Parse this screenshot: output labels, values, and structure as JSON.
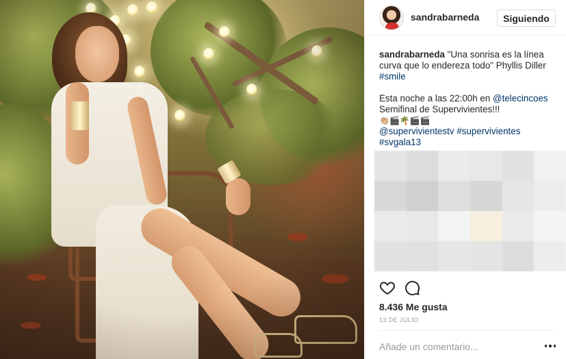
{
  "post": {
    "username": "sandrabarneda",
    "follow_button": "Siguiendo",
    "photo_alt": "",
    "caption": {
      "username": "sandrabarneda",
      "quote": " \"Una sonrisa es la línea curva que lo endereza todo\" Phyllis Diller ",
      "hashtag_smile": "#smile",
      "line2_prefix": "Esta noche a las 22:00h en ",
      "mention_telecinco": "@telecincoes",
      "line3": "Semifinal de Supervivientes!!!",
      "emoji_line": "👏🏼🎬🌴🎬🎬",
      "mention_supervivientes": "@supervivientestv",
      "hashtag_supervivientes": "#supervivientes",
      "hashtag_svgala": "#svgala13"
    },
    "likes": "8.436 Me gusta",
    "date": "13 DE JULIO",
    "comment_placeholder": "Añade un comentario..."
  },
  "colors": {
    "text": "#262626",
    "link": "#003569",
    "muted": "#999999",
    "border": "#efefef"
  },
  "icons": {
    "like": "heart-outline-icon",
    "comment": "speech-bubble-icon",
    "more": "ellipsis-icon"
  },
  "blurred_block_colors": [
    "#e4e4e4",
    "#dcdcdc",
    "#ebebeb",
    "#e8e8e8",
    "#e2e2e2",
    "#f2f2f2",
    "#d8d8d8",
    "#d2d0ce",
    "#dedede",
    "#d6d6d6",
    "#e6e6e6",
    "#ececec",
    "#eaeaea",
    "#e8e8e8",
    "#f3f3f3",
    "#f6efe0",
    "#ebebeb",
    "#f4f4f4",
    "#e2e2e2",
    "#e0e0e0",
    "#e6e6e6",
    "#e4e4e4",
    "#dcdcdc",
    "#ededed"
  ]
}
